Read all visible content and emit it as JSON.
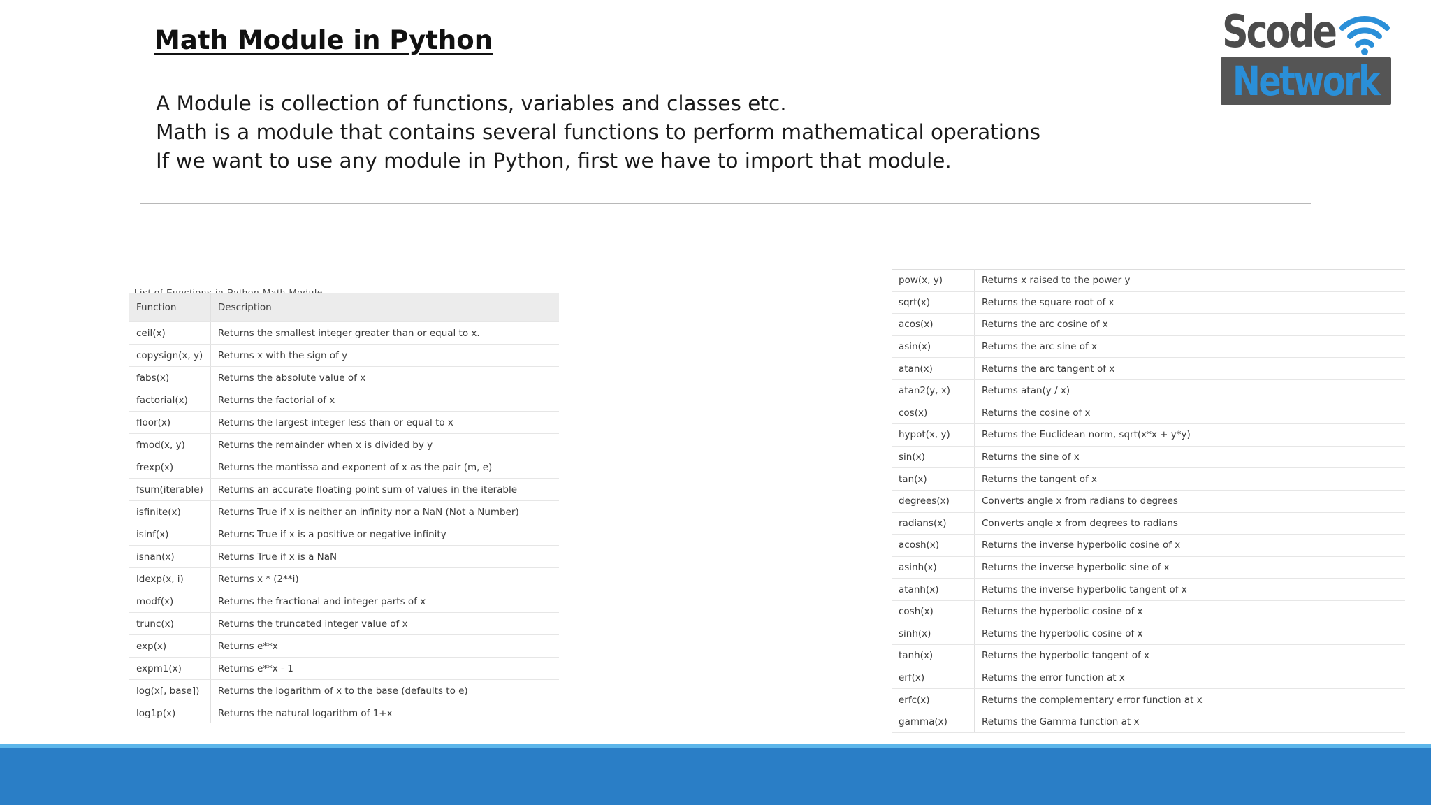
{
  "title": "Math Module in Python",
  "intro": [
    "A Module is collection of functions, variables and classes etc.",
    "Math is a module that contains several functions to perform mathematical operations",
    "If we want to use any module in Python, first we have to import that module."
  ],
  "logo": {
    "line1": "Scode",
    "line2": "Network",
    "icon": "wifi-icon"
  },
  "left_table": {
    "caption": "List of Functions in Python Math Module",
    "headers": [
      "Function",
      "Description"
    ],
    "rows": [
      [
        "ceil(x)",
        "Returns the smallest integer greater than or equal to x."
      ],
      [
        "copysign(x, y)",
        "Returns x with the sign of y"
      ],
      [
        "fabs(x)",
        "Returns the absolute value of x"
      ],
      [
        "factorial(x)",
        "Returns the factorial of x"
      ],
      [
        "floor(x)",
        "Returns the largest integer less than or equal to x"
      ],
      [
        "fmod(x, y)",
        "Returns the remainder when x is divided by y"
      ],
      [
        "frexp(x)",
        "Returns the mantissa and exponent of x as the pair (m, e)"
      ],
      [
        "fsum(iterable)",
        "Returns an accurate floating point sum of values in the iterable"
      ],
      [
        "isfinite(x)",
        "Returns True if x is neither an infinity nor a NaN (Not a Number)"
      ],
      [
        "isinf(x)",
        "Returns True if x is a positive or negative infinity"
      ],
      [
        "isnan(x)",
        "Returns True if x is a NaN"
      ],
      [
        "ldexp(x, i)",
        "Returns x * (2**i)"
      ],
      [
        "modf(x)",
        "Returns the fractional and integer parts of x"
      ],
      [
        "trunc(x)",
        "Returns the truncated integer value of x"
      ],
      [
        "exp(x)",
        "Returns e**x"
      ],
      [
        "expm1(x)",
        "Returns e**x - 1"
      ],
      [
        "log(x[, base])",
        "Returns the logarithm of x to the base (defaults to e)"
      ],
      [
        "log1p(x)",
        "Returns the natural logarithm of 1+x"
      ]
    ]
  },
  "right_table": {
    "rows": [
      [
        "pow(x, y)",
        "Returns x raised to the power y"
      ],
      [
        "sqrt(x)",
        "Returns the square root of x"
      ],
      [
        "acos(x)",
        "Returns the arc cosine of x"
      ],
      [
        "asin(x)",
        "Returns the arc sine of x"
      ],
      [
        "atan(x)",
        "Returns the arc tangent of x"
      ],
      [
        "atan2(y, x)",
        "Returns atan(y / x)"
      ],
      [
        "cos(x)",
        "Returns the cosine of x"
      ],
      [
        "hypot(x, y)",
        "Returns the Euclidean norm, sqrt(x*x + y*y)"
      ],
      [
        "sin(x)",
        "Returns the sine of x"
      ],
      [
        "tan(x)",
        "Returns the tangent of x"
      ],
      [
        "degrees(x)",
        "Converts angle x from radians to degrees"
      ],
      [
        "radians(x)",
        "Converts angle x from degrees to radians"
      ],
      [
        "acosh(x)",
        "Returns the inverse hyperbolic cosine of x"
      ],
      [
        "asinh(x)",
        "Returns the inverse hyperbolic sine of x"
      ],
      [
        "atanh(x)",
        "Returns the inverse hyperbolic tangent of x"
      ],
      [
        "cosh(x)",
        "Returns the hyperbolic cosine of x"
      ],
      [
        "sinh(x)",
        "Returns the hyperbolic cosine of x"
      ],
      [
        "tanh(x)",
        "Returns the hyperbolic tangent of x"
      ],
      [
        "erf(x)",
        "Returns the error function at x"
      ],
      [
        "erfc(x)",
        "Returns the complementary error function at x"
      ],
      [
        "gamma(x)",
        "Returns the Gamma function at x"
      ]
    ]
  },
  "colors": {
    "footer": "#2a7ec6",
    "footer_accent": "#5cb6ea",
    "logo_blue": "#2a8fd8"
  }
}
